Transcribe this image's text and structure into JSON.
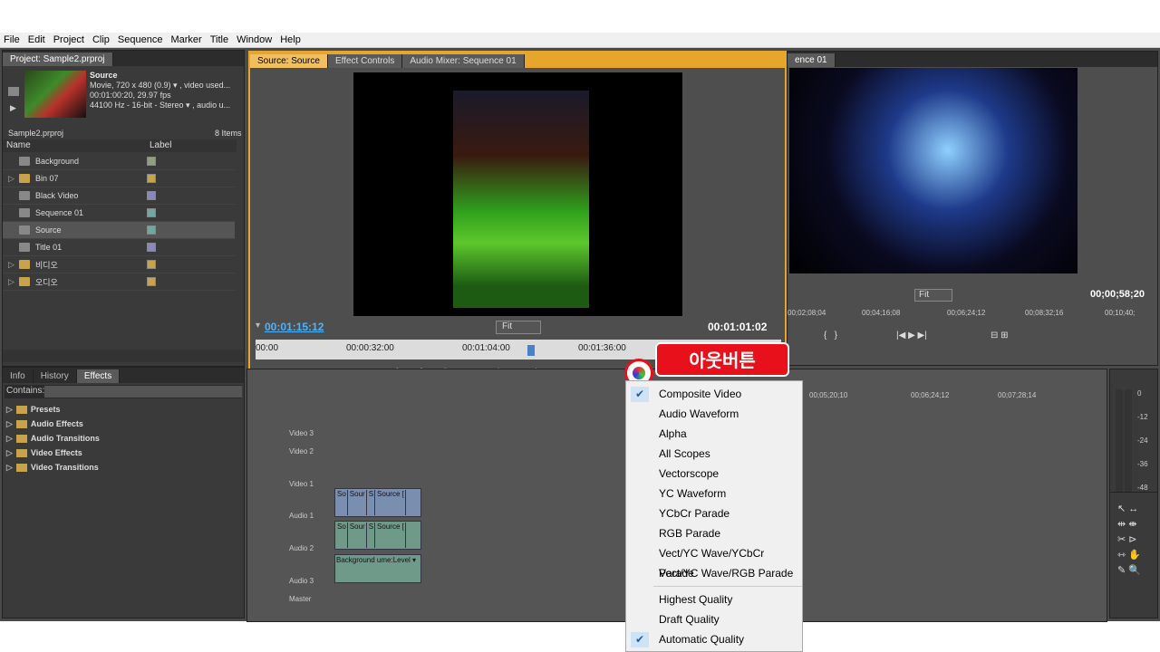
{
  "menubar": [
    "File",
    "Edit",
    "Project",
    "Clip",
    "Sequence",
    "Marker",
    "Title",
    "Window",
    "Help"
  ],
  "project": {
    "tab": "Project: Sample2.prproj",
    "clip_name": "Source",
    "clip_info1": "Movie, 720 x 480 (0.9)  ▾  , video used...",
    "clip_info2": "00:01:00:20, 29.97 fps",
    "clip_info3": "44100 Hz - 16-bit - Stereo  ▾  , audio u...",
    "file": "Sample2.prproj",
    "count": "8 Items",
    "col_name": "Name",
    "col_label": "Label",
    "items": [
      {
        "name": "Background",
        "type": "audio",
        "color": "#8fa07a"
      },
      {
        "name": "Bin 07",
        "type": "folder",
        "color": "#c9a34a"
      },
      {
        "name": "Black Video",
        "type": "video",
        "color": "#8a86c0"
      },
      {
        "name": "Sequence 01",
        "type": "seq",
        "color": "#6fa8a0"
      },
      {
        "name": "Source",
        "type": "video",
        "color": "#6fa8a0"
      },
      {
        "name": "Title 01",
        "type": "title",
        "color": "#8a86c0"
      },
      {
        "name": "비디오",
        "type": "folder",
        "color": "#c9a34a"
      },
      {
        "name": "오디오",
        "type": "folder",
        "color": "#c9a34a"
      }
    ]
  },
  "effects": {
    "tabs": [
      "Info",
      "History",
      "Effects"
    ],
    "contains": "Contains:",
    "items": [
      "Presets",
      "Audio Effects",
      "Audio Transitions",
      "Video Effects",
      "Video Transitions"
    ]
  },
  "source": {
    "tabs": [
      "Source: Source",
      "Effect Controls",
      "Audio Mixer: Sequence 01"
    ],
    "timecode_in": "00:01:15:12",
    "fit": "Fit",
    "timecode_dur": "00:01:01:02",
    "ruler": [
      "00:00",
      "00:00:32:00",
      "00:01:04:00",
      "00:01:36:00"
    ]
  },
  "program": {
    "tab": "ence 01",
    "fit": "Fit",
    "timecode": "00;00;58;20",
    "ruler": [
      "00;02;08;04",
      "00;04;16;08",
      "00;06;24;12",
      "00;08;32;16",
      "00;10;40;"
    ]
  },
  "timeline": {
    "ruler": [
      "00;05;20;10",
      "00;06;24;12",
      "00;07;28;14"
    ],
    "tracks": [
      "Video 3",
      "Video 2",
      "Video 1",
      "Audio 1",
      "Audio 2",
      "Audio 3",
      "Master"
    ],
    "clips_v1": [
      "So",
      "Sour",
      "S",
      "Source ["
    ],
    "clips_a1": [
      "So",
      "Sour",
      "S",
      "Source ["
    ],
    "clip_a2": "Background  ume:Level ▾"
  },
  "meter": [
    "0",
    "-12",
    "-24",
    "-36",
    "-48"
  ],
  "dropdown": {
    "items": [
      {
        "label": "Composite Video",
        "checked": true
      },
      {
        "label": "Audio Waveform",
        "checked": false
      },
      {
        "label": "Alpha",
        "checked": false
      },
      {
        "label": "All Scopes",
        "checked": false
      },
      {
        "label": "Vectorscope",
        "checked": false
      },
      {
        "label": "YC Waveform",
        "checked": false
      },
      {
        "label": "YCbCr Parade",
        "checked": false
      },
      {
        "label": "RGB Parade",
        "checked": false
      },
      {
        "label": "Vect/YC Wave/YCbCr Parade",
        "checked": false
      },
      {
        "label": "Vect/YC Wave/RGB Parade",
        "checked": false
      }
    ],
    "quality": [
      {
        "label": "Highest Quality",
        "checked": false
      },
      {
        "label": "Draft Quality",
        "checked": false
      },
      {
        "label": "Automatic Quality",
        "checked": true
      }
    ]
  },
  "callout": "아웃버튼"
}
